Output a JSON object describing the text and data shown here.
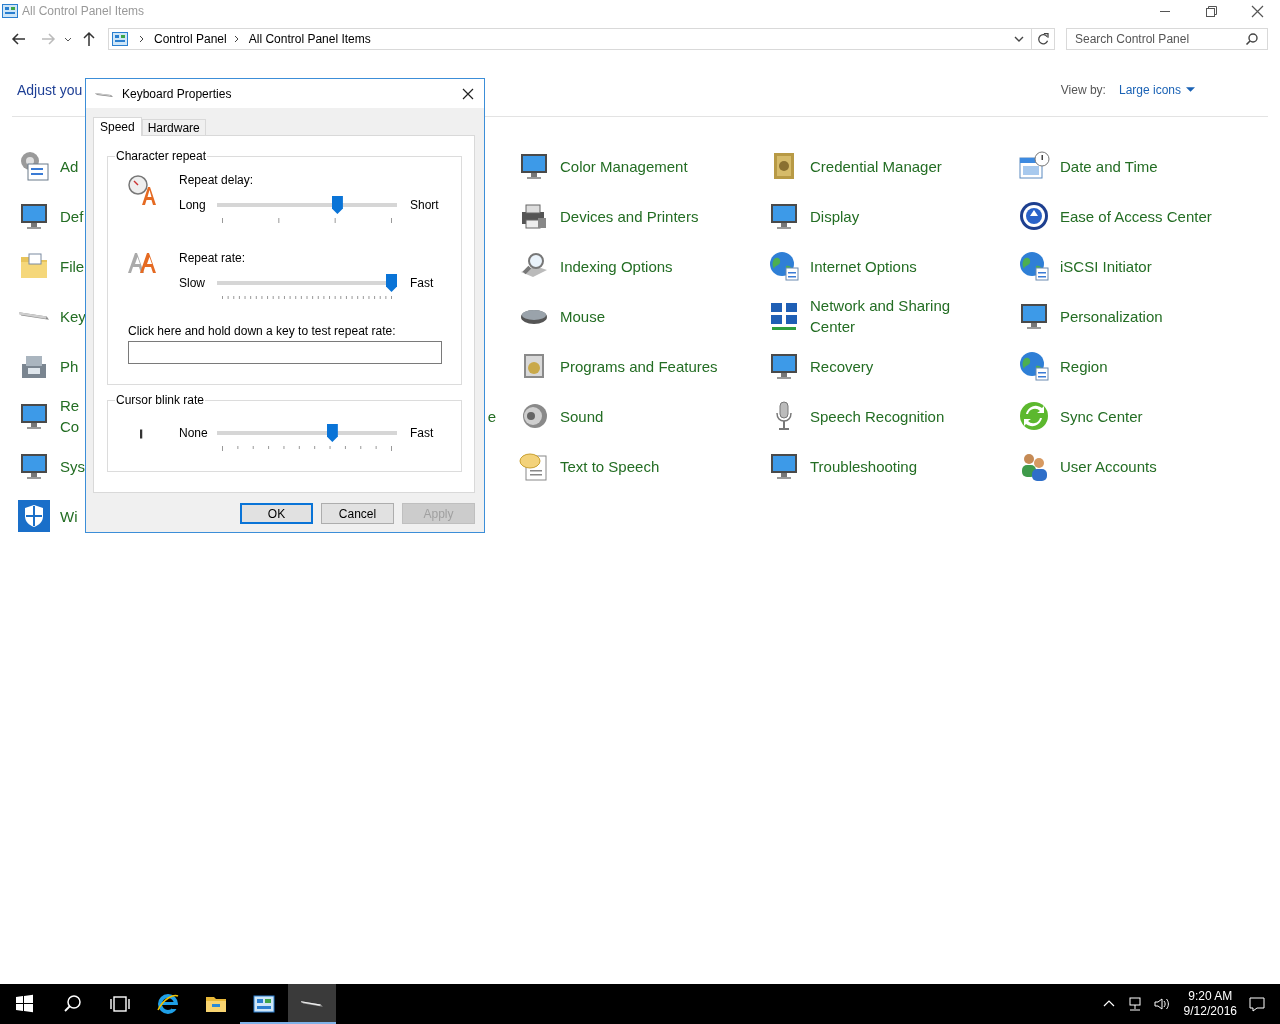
{
  "window": {
    "title": "All Control Panel Items"
  },
  "address_bar": {
    "crumbs": [
      "Control Panel",
      "All Control Panel Items"
    ]
  },
  "search": {
    "placeholder": "Search Control Panel"
  },
  "heading": "Adjust you",
  "view_by": {
    "label": "View by:",
    "value": "Large icons"
  },
  "columns": [
    {
      "items": [
        "Ad",
        "Def",
        "File",
        "Key",
        "Ph",
        "Re Co",
        "Sys",
        "Wi"
      ]
    },
    {
      "fragment": "e"
    },
    {
      "items": [
        "Color Management",
        "Devices and Printers",
        "Indexing Options",
        "Mouse",
        "Programs and Features",
        "Sound",
        "Text to Speech"
      ]
    },
    {
      "items": [
        "Credential Manager",
        "Display",
        "Internet Options",
        "Network and Sharing Center",
        "Recovery",
        "Speech Recognition",
        "Troubleshooting"
      ]
    },
    {
      "items": [
        "Date and Time",
        "Ease of Access Center",
        "iSCSI Initiator",
        "Personalization",
        "Region",
        "Sync Center",
        "User Accounts"
      ]
    }
  ],
  "dialog": {
    "title": "Keyboard Properties",
    "tabs": [
      {
        "label": "Speed",
        "selected": true
      },
      {
        "label": "Hardware",
        "selected": false
      }
    ],
    "character_repeat": {
      "title": "Character repeat",
      "sliders": [
        {
          "label": "Repeat delay:",
          "min_label": "Long",
          "max_label": "Short",
          "level": 0.68
        },
        {
          "label": "Repeat rate:",
          "min_label": "Slow",
          "max_label": "Fast",
          "level": 1.0
        }
      ],
      "test_label": "Click here and hold down a key to test repeat rate:"
    },
    "cursor_blink": {
      "title": "Cursor blink rate",
      "min_label": "None",
      "max_label": "Fast",
      "level": 0.65
    },
    "buttons": [
      {
        "label": "OK",
        "default": true,
        "disabled": false
      },
      {
        "label": "Cancel",
        "default": false,
        "disabled": false
      },
      {
        "label": "Apply",
        "default": false,
        "disabled": true
      }
    ]
  },
  "taskbar": {
    "apps": [
      {
        "running": false,
        "selected": false
      },
      {
        "running": false,
        "selected": false
      },
      {
        "running": true,
        "selected": false
      },
      {
        "running": true,
        "selected": true
      }
    ],
    "time": "9:20 AM",
    "date": "9/12/2016"
  }
}
